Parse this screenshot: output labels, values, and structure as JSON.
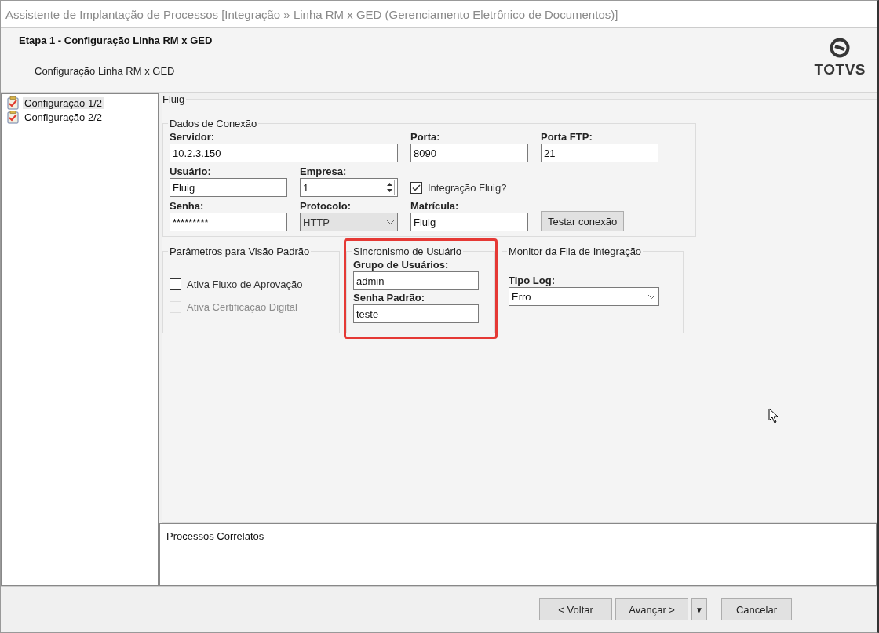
{
  "window": {
    "title": "Assistente de Implantação de Processos [Integração » Linha RM x GED (Gerenciamento Eletrônico de Documentos)]"
  },
  "header": {
    "title": "Etapa 1 - Configuração Linha RM x GED",
    "subtitle": "Configuração Linha RM x GED",
    "logo": "TOTVS"
  },
  "sidebar": {
    "items": [
      {
        "label": "Configuração 1/2",
        "selected": true
      },
      {
        "label": "Configuração 2/2",
        "selected": false
      }
    ]
  },
  "main_group": {
    "title": "Fluig",
    "connection": {
      "title": "Dados de Conexão",
      "fields": [
        {
          "kind": "text",
          "label": "Servidor:",
          "value": "10.2.3.150"
        },
        {
          "kind": "text",
          "label": "Porta:",
          "value": "8090"
        },
        {
          "kind": "text",
          "label": "Porta FTP:",
          "value": "21"
        },
        {
          "kind": "text",
          "label": "Usuário:",
          "value": "Fluig"
        },
        {
          "kind": "spinner",
          "label": "Empresa:",
          "value": "1"
        },
        {
          "kind": "checkbox",
          "label": "Integração Fluig?",
          "checked": true,
          "disabled": false
        },
        {
          "kind": "text",
          "label": "Senha:",
          "value": "*********"
        },
        {
          "kind": "select",
          "label": "Protocolo:",
          "value": "HTTP",
          "disabled": true
        },
        {
          "kind": "text",
          "label": "Matrícula:",
          "value": "Fluig"
        },
        {
          "kind": "button",
          "label": "Testar conexão"
        }
      ]
    },
    "groups": [
      {
        "title": "Parâmetros para Visão Padrão",
        "highlighted": false,
        "items": [
          {
            "kind": "checkbox",
            "label": "Ativa Fluxo de Aprovação",
            "checked": false,
            "disabled": false
          },
          {
            "kind": "checkbox",
            "label": "Ativa Certificação Digital",
            "checked": false,
            "disabled": true
          }
        ]
      },
      {
        "title": "Sincronismo de Usuário",
        "highlighted": true,
        "items": [
          {
            "kind": "text",
            "label": "Grupo de Usuários:",
            "value": "admin"
          },
          {
            "kind": "text",
            "label": "Senha Padrão:",
            "value": "teste"
          }
        ]
      },
      {
        "title": "Monitor da Fila de Integração",
        "highlighted": false,
        "items": [
          {
            "kind": "select",
            "label": "Tipo Log:",
            "value": "Erro",
            "disabled": false
          }
        ]
      }
    ]
  },
  "related": {
    "title": "Processos Correlatos"
  },
  "buttons": [
    {
      "label": "< Voltar",
      "kind": "button"
    },
    {
      "label": "Avançar >",
      "kind": "button"
    },
    {
      "label": "▼",
      "kind": "menu"
    },
    {
      "label": "Cancelar",
      "kind": "button"
    }
  ]
}
